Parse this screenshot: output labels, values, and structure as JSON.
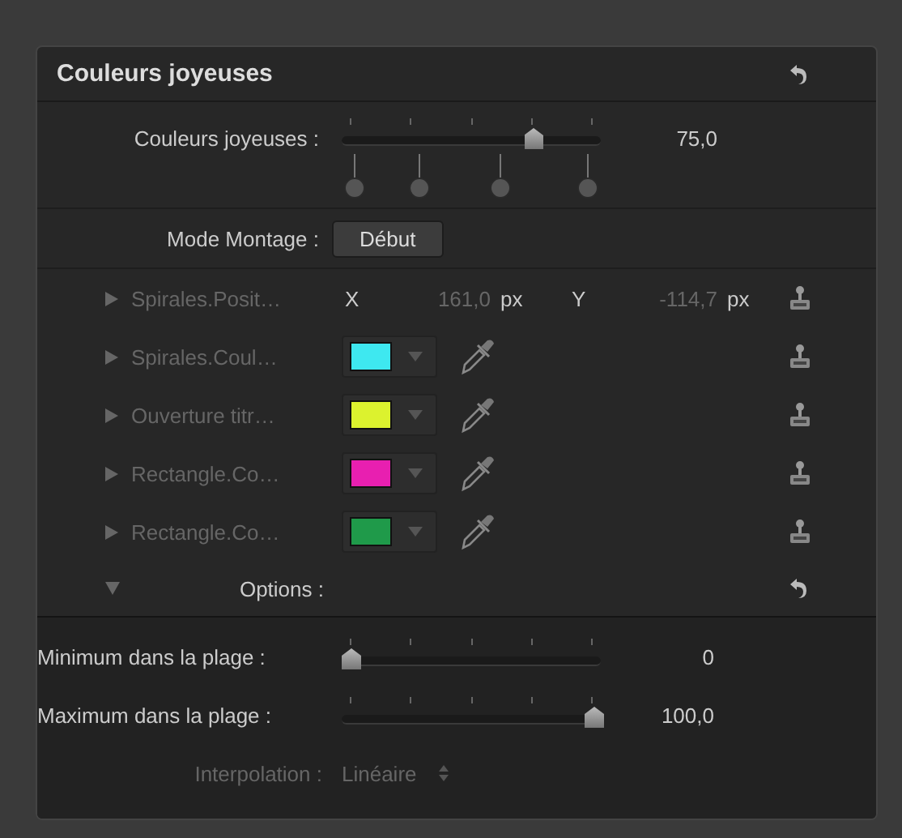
{
  "panel": {
    "title": "Couleurs joyeuses"
  },
  "main_slider": {
    "label": "Couleurs joyeuses :",
    "level": 0.75,
    "reading": "75,0"
  },
  "mode": {
    "label": "Mode Montage :",
    "button": "Début"
  },
  "parameters": [
    {
      "kind": "position",
      "label": "Spirales.Posit…",
      "disabled": true,
      "x_label": "X",
      "x_value": "161,0",
      "x_unit": "px",
      "y_label": "Y",
      "y_value": "-114,7",
      "y_unit": "px"
    },
    {
      "kind": "color",
      "label": "Spirales.Coul…",
      "disabled": true,
      "color": "#3ee8f0"
    },
    {
      "kind": "color",
      "label": "Ouverture titr…",
      "disabled": true,
      "color": "#dcf22e"
    },
    {
      "kind": "color",
      "label": "Rectangle.Co…",
      "disabled": true,
      "color": "#e81fb0"
    },
    {
      "kind": "color",
      "label": "Rectangle.Co…",
      "disabled": true,
      "color": "#1f9a4a"
    }
  ],
  "options": {
    "label": "Options :",
    "expanded": true,
    "items": [
      {
        "kind": "slider",
        "label": "Minimum dans la plage :",
        "level": 0,
        "reading": "0"
      },
      {
        "kind": "slider",
        "label": "Maximum dans la plage :",
        "level": 1,
        "reading": "100,0"
      },
      {
        "kind": "popup",
        "label": "Interpolation :",
        "value": "Linéaire",
        "disabled": true
      }
    ]
  }
}
